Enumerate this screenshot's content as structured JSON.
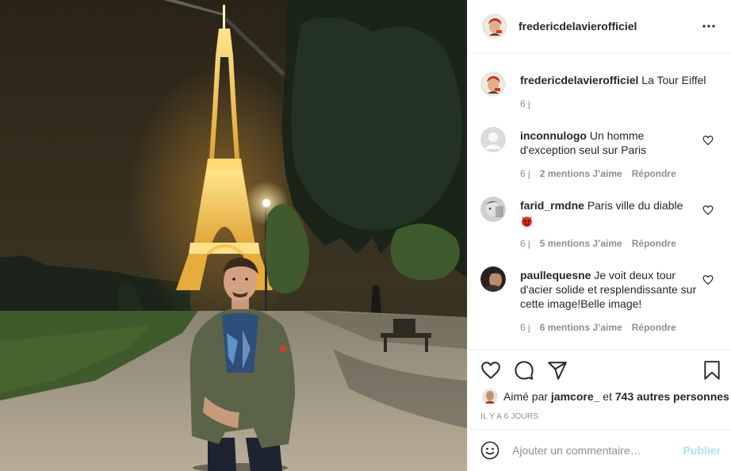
{
  "post": {
    "author": "fredericdelavierofficiel",
    "caption": "La Tour Eiffel",
    "caption_age": "6 j",
    "photo_alt": "Photo",
    "more_icon": "more-horizontal-icon"
  },
  "comments": [
    {
      "username": "inconnulogo",
      "text": "Un homme d'exception seul sur Paris",
      "age": "6 j",
      "likes": "2 mentions J’aime",
      "reply": "Répondre"
    },
    {
      "username": "farid_rmdne",
      "text": "Paris ville du diable",
      "emoji": "😈",
      "age": "6 j",
      "likes": "5 mentions J’aime",
      "reply": "Répondre"
    },
    {
      "username": "paullequesne",
      "text": "Je voit deux tour d'acier solide et resplendissante sur cette image!Belle image!",
      "age": "6 j",
      "likes": "6 mentions J’aime",
      "reply": "Répondre"
    }
  ],
  "actions": {
    "like_icon": "heart-icon",
    "comment_icon": "comment-icon",
    "share_icon": "paper-plane-icon",
    "save_icon": "bookmark-icon"
  },
  "likes": {
    "prefix": "Aimé par",
    "user": "jamcore_",
    "connector": "et",
    "others": "743 autres personnes"
  },
  "date": "IL Y A 6 JOURS",
  "add_comment": {
    "placeholder": "Ajouter un commentaire…",
    "publish": "Publier"
  },
  "colors": {
    "text": "#262626",
    "muted": "#8e8e8e",
    "border": "#efefef",
    "publish_disabled": "#b2dffc",
    "devil_emoji": "#d5321f"
  }
}
